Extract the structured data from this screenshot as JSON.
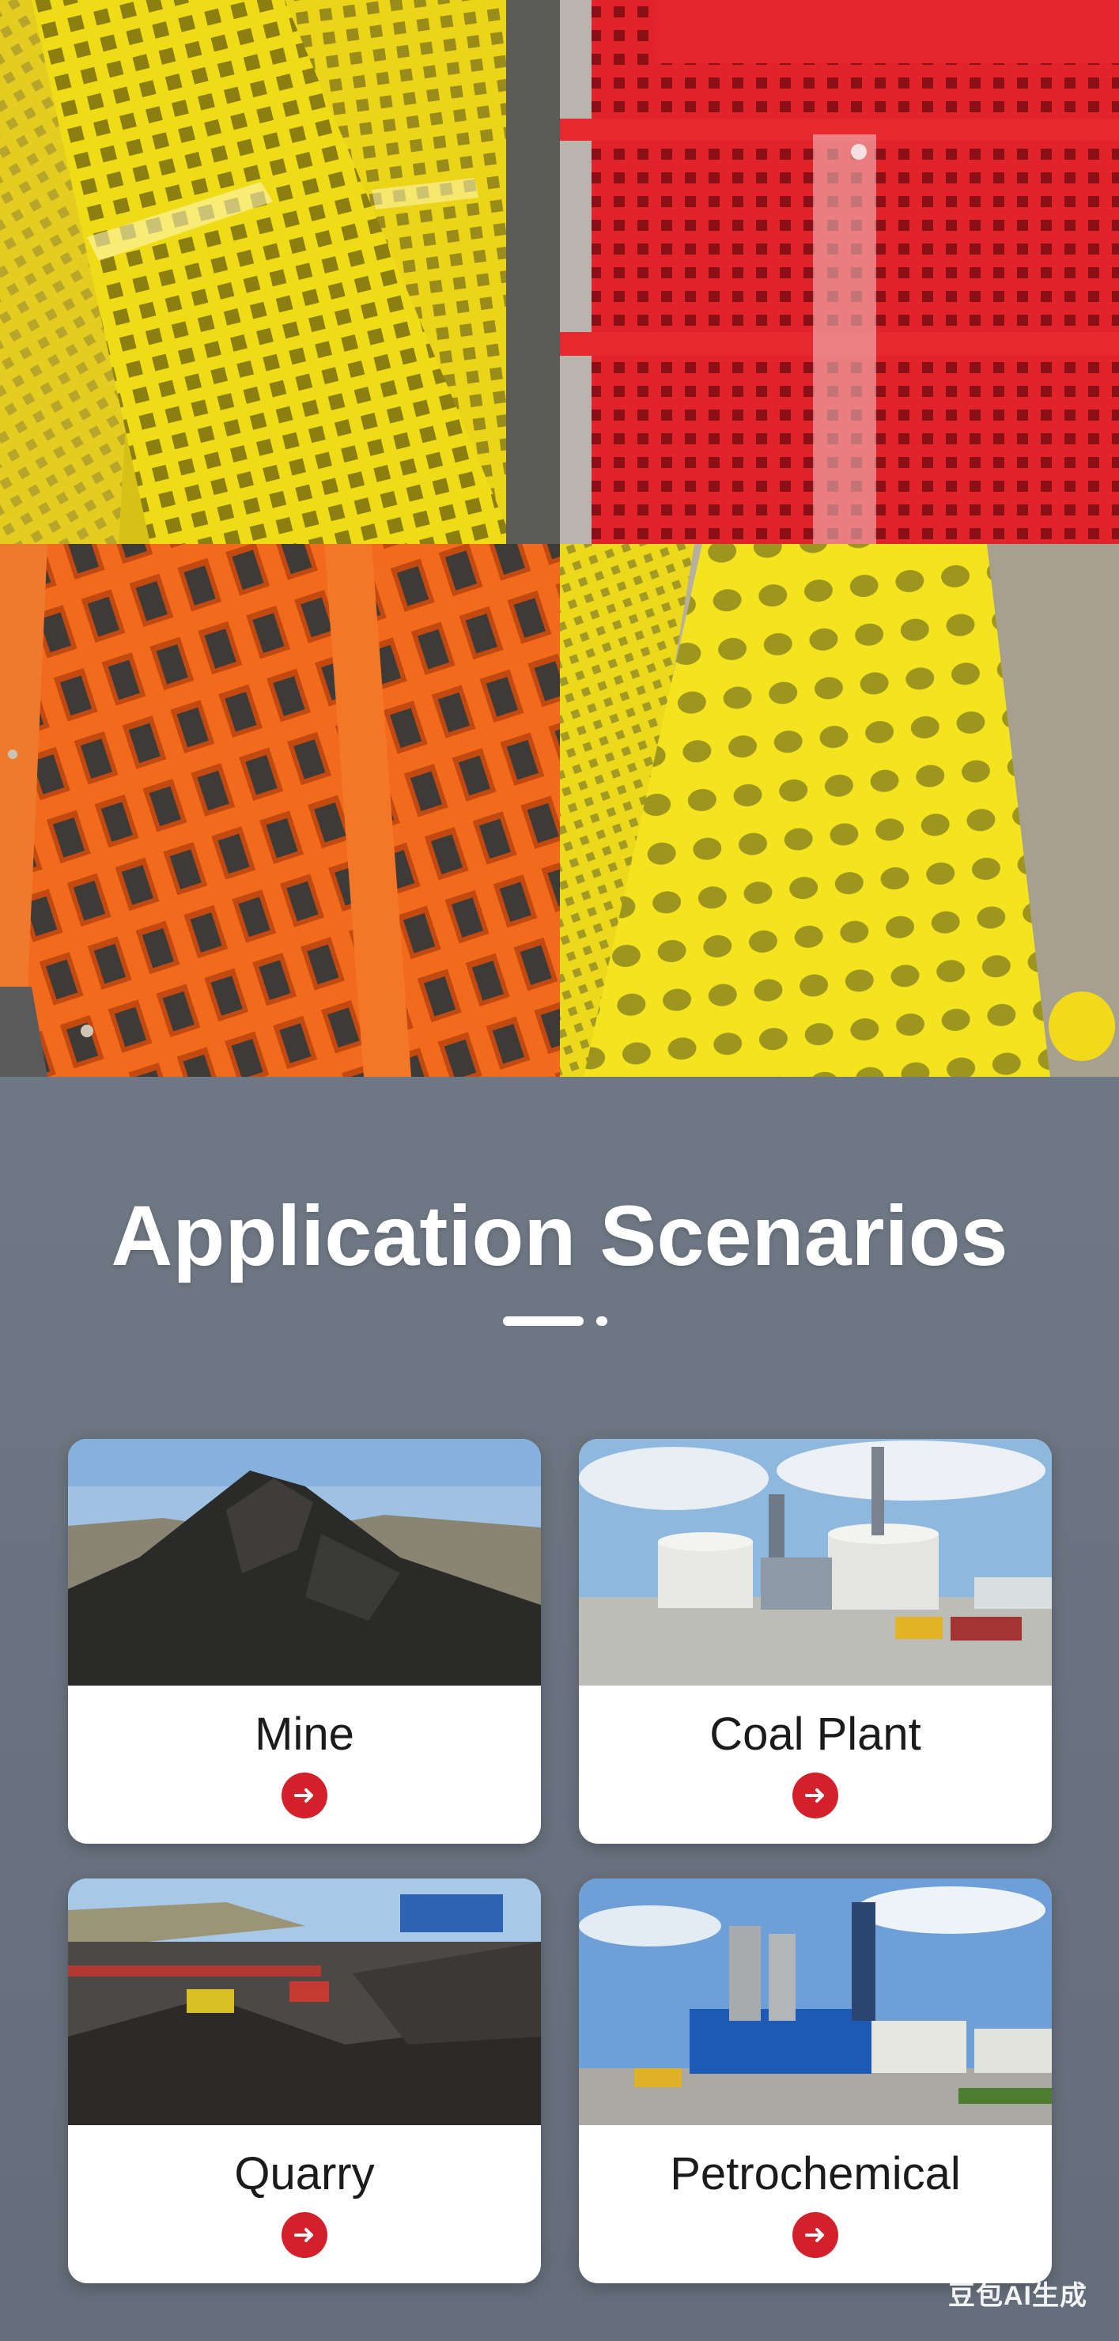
{
  "section": {
    "title": "Application Scenarios"
  },
  "cards": [
    {
      "label": "Mine",
      "photo_icon": "coal-pile-photo",
      "arrow_icon": "arrow-right-icon"
    },
    {
      "label": "Coal Plant",
      "photo_icon": "industrial-plant-photo",
      "arrow_icon": "arrow-right-icon"
    },
    {
      "label": "Quarry",
      "photo_icon": "quarry-site-photo",
      "arrow_icon": "arrow-right-icon"
    },
    {
      "label": "Petrochemical",
      "photo_icon": "petrochemical-plant-photo",
      "arrow_icon": "arrow-right-icon"
    }
  ],
  "product_photos": [
    {
      "icon": "yellow-square-mesh-panel-photo",
      "color": "#f1df1d"
    },
    {
      "icon": "red-square-mesh-panel-photo",
      "color": "#e3252c"
    },
    {
      "icon": "orange-rectangular-mesh-panel-photo",
      "color": "#f26a1b"
    },
    {
      "icon": "yellow-round-hole-panel-photo",
      "color": "#f3e81f"
    }
  ],
  "watermark": "豆包AI生成",
  "colors": {
    "background": "#6c7683",
    "card": "#ffffff",
    "accent": "#d3202b"
  }
}
